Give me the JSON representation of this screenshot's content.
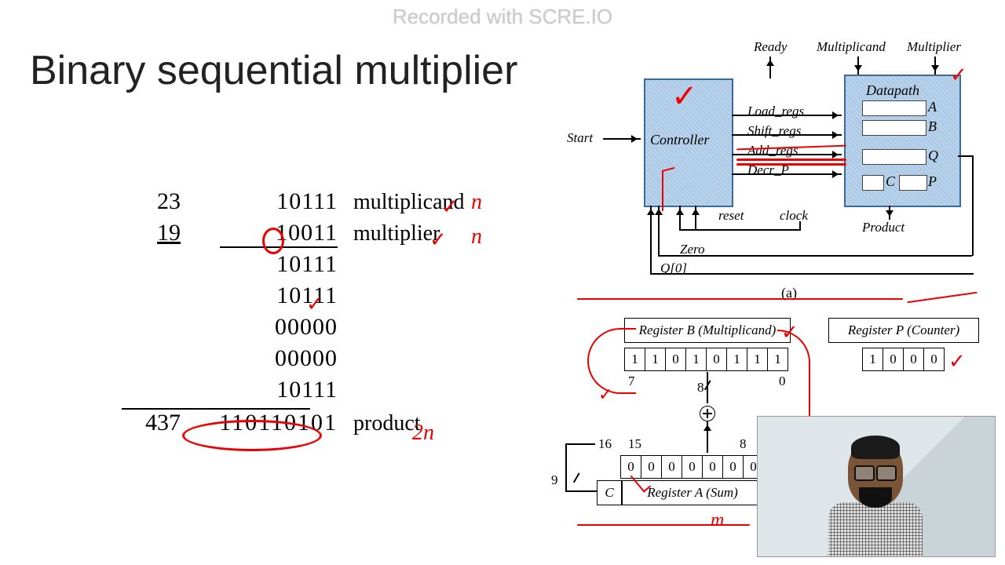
{
  "watermark": "Recorded with SCRE.IO",
  "title": "Binary sequential multiplier",
  "calc": {
    "dec_multiplicand": "23",
    "bin_multiplicand": "10111",
    "label_multiplicand": "multiplicand",
    "dec_multiplier": "19",
    "bin_multiplier": "10011",
    "label_multiplier": "multiplier",
    "partials": [
      "10111",
      "10111",
      "00000",
      "00000",
      "10111"
    ],
    "dec_product": "437",
    "bin_product": "110110101",
    "label_product": "product",
    "ann_n1": "n",
    "ann_n2": "n",
    "ann_2n": "2n"
  },
  "diagA": {
    "top_labels": {
      "ready": "Ready",
      "multiplicand": "Multiplicand",
      "multiplier": "Multiplier"
    },
    "controller": "Controller",
    "datapath": "Datapath",
    "start": "Start",
    "signals": [
      "Load_regs",
      "Shift_regs",
      "Add_regs",
      "Decr_P"
    ],
    "reset": "reset",
    "clock": "clock",
    "zero": "Zero",
    "q0": "Q[0]",
    "product": "Product",
    "regs": {
      "A": "A",
      "B": "B",
      "Q": "Q",
      "C": "C",
      "P": "P"
    },
    "caption": "(a)"
  },
  "diagB": {
    "regB_label": "Register B (Multiplicand)",
    "regB_bits": [
      "1",
      "1",
      "0",
      "1",
      "0",
      "1",
      "1",
      "1"
    ],
    "regB_left_idx": "7",
    "regB_right_idx": "0",
    "regP_label": "Register P (Counter)",
    "regP_bits": [
      "1",
      "0",
      "0",
      "0"
    ],
    "regA_label": "Register A (Sum)",
    "regA_bits": [
      "0",
      "0",
      "0",
      "0",
      "0",
      "0",
      "0"
    ],
    "c_label": "C",
    "idx16": "16",
    "idx15": "15",
    "idx8": "8",
    "idx9": "9",
    "slash8": "8"
  }
}
